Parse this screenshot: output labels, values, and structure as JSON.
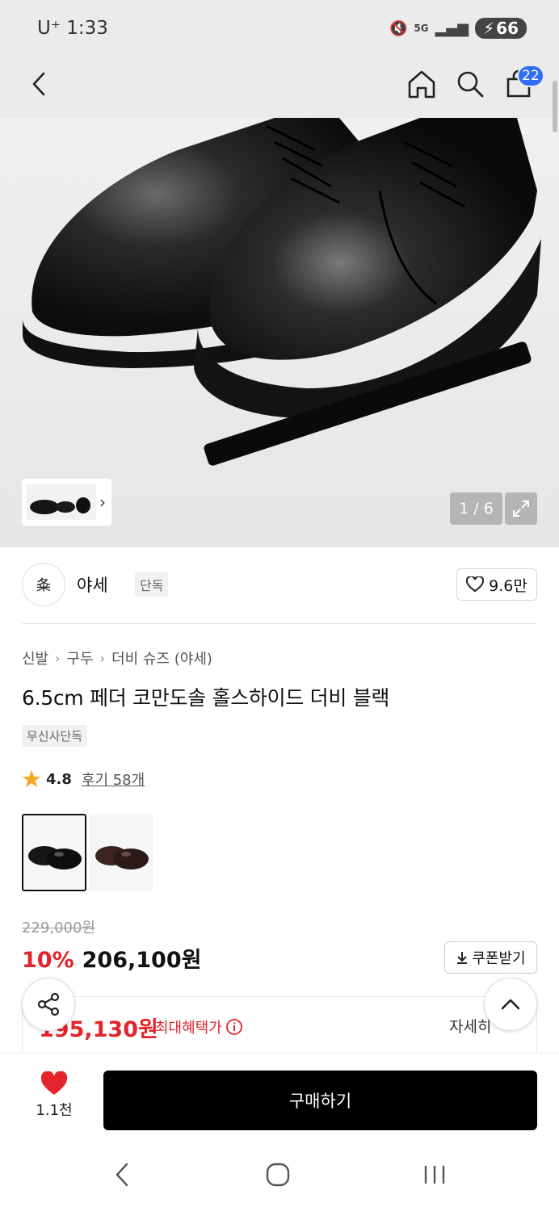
{
  "status": {
    "carrier": "U⁺ 1:33",
    "network": "5G",
    "battery": "66"
  },
  "header": {
    "back_icon": "chevron-left-icon",
    "home_icon": "home-icon",
    "search_icon": "search-icon",
    "cart_icon": "shopping-bag-icon",
    "cart_count": "22"
  },
  "gallery": {
    "counter": "1 / 6",
    "expand_icon": "expand-icon"
  },
  "brand": {
    "logo_text": "夈",
    "name": "야세",
    "tag": "단독",
    "like_count": "9.6만"
  },
  "breadcrumb": [
    "신발",
    "구두",
    "더비 슈즈 (야세)"
  ],
  "product": {
    "title": "6.5cm 페더 코만도솔 홀스하이드 더비 블랙",
    "exclusive_tag": "무신사단독",
    "rating": "4.8",
    "reviews": "후기 58개"
  },
  "colors": {
    "accent": "#e3242b",
    "star": "#f5a623",
    "badge": "#2f6df5"
  },
  "pricing": {
    "original": "229,000원",
    "discount": "10%",
    "price": "206,100원",
    "coupon_label": "쿠폰받기",
    "max_benefit_price": "195,130원",
    "max_benefit_label": "최대혜택가",
    "detail_label": "자세히"
  },
  "bottom": {
    "like_count": "1.1천",
    "buy_label": "구매하기"
  }
}
